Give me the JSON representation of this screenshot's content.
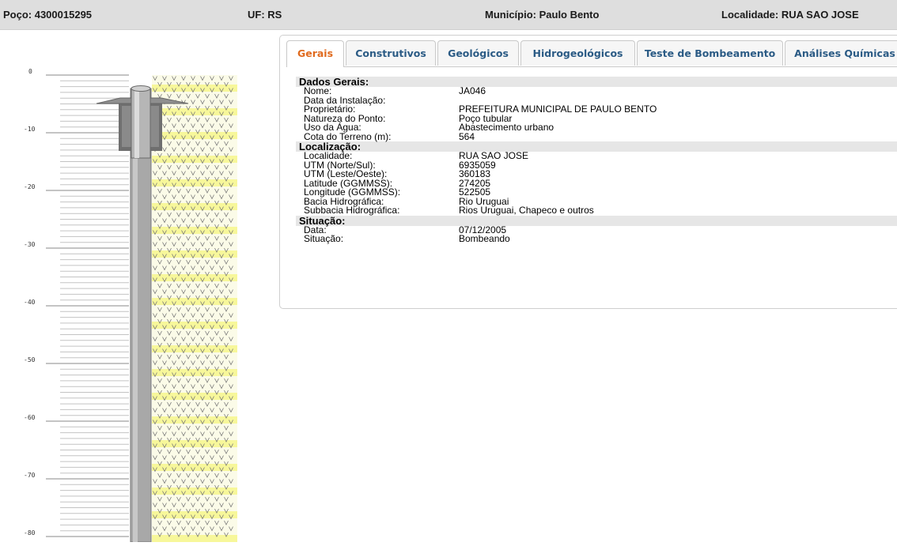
{
  "header": {
    "poco": "Poço: 4300015295",
    "uf": "UF: RS",
    "municipio": "Município: Paulo Bento",
    "localidade": "Localidade: RUA SAO JOSE"
  },
  "profile": {
    "depth_labels": [
      "0",
      "-10",
      "-20",
      "-30",
      "-40",
      "-50",
      "-60",
      "-70",
      "-80"
    ],
    "colors": {
      "casing": "#a8a8a8",
      "fill": "#fbfbe8",
      "highlight": "#f7f79a",
      "v_mark": "#777777"
    }
  },
  "tabs": [
    {
      "label": "Gerais",
      "active": true
    },
    {
      "label": "Construtivos",
      "active": false
    },
    {
      "label": "Geológicos",
      "active": false
    },
    {
      "label": "Hidrogeológicos",
      "active": false
    },
    {
      "label": "Teste de Bombeamento",
      "active": false
    },
    {
      "label": "Análises Químicas",
      "active": false
    }
  ],
  "sections": {
    "dados_gerais": {
      "title": "Dados Gerais:",
      "rows": [
        {
          "label": "Nome:",
          "value": "JA046"
        },
        {
          "label": "Data da Instalação:",
          "value": ""
        },
        {
          "label": "Proprietário:",
          "value": "PREFEITURA MUNICIPAL DE PAULO BENTO"
        },
        {
          "label": "Natureza do Ponto:",
          "value": "Poço tubular"
        },
        {
          "label": "Uso da Água:",
          "value": "Abastecimento urbano"
        },
        {
          "label": "Cota do Terreno (m):",
          "value": "564"
        }
      ]
    },
    "localizacao": {
      "title": "Localização:",
      "rows": [
        {
          "label": "Localidade:",
          "value": "RUA SAO JOSE"
        },
        {
          "label": "UTM (Norte/Sul):",
          "value": "6935059"
        },
        {
          "label": "UTM (Leste/Oeste):",
          "value": "360183"
        },
        {
          "label": "Latitude (GGMMSS):",
          "value": "274205"
        },
        {
          "label": "Longitude (GGMMSS):",
          "value": "522505"
        },
        {
          "label": "Bacia Hidrográfica:",
          "value": "Rio Uruguai"
        },
        {
          "label": "Subbacia Hidrográfica:",
          "value": "Rios Uruguai, Chapeco e outros"
        }
      ]
    },
    "situacao": {
      "title": "Situação:",
      "rows": [
        {
          "label": "Data:",
          "value": "07/12/2005"
        },
        {
          "label": "Situação:",
          "value": "Bombeando"
        }
      ]
    }
  }
}
